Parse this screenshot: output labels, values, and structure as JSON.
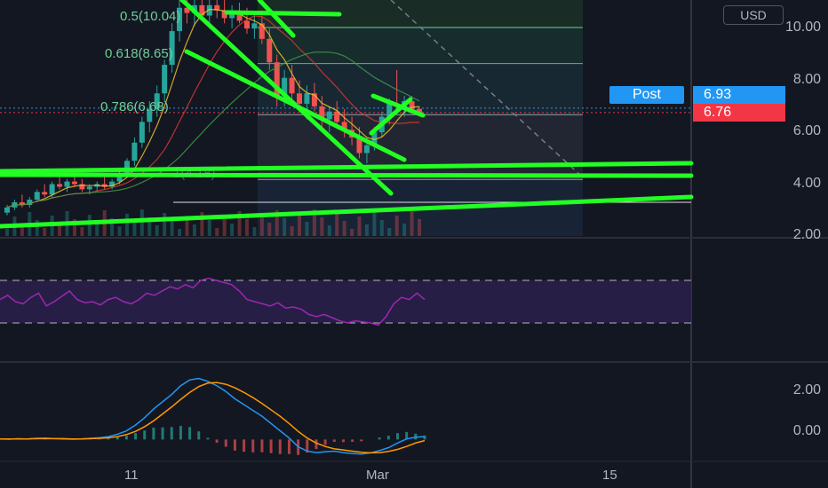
{
  "currency": "USD",
  "post_label": "Post",
  "price_badges": {
    "post_price": "6.93",
    "last_price": "6.76"
  },
  "fib_labels": {
    "level_050": "0.5(10.04)",
    "level_0618": "0.618(8.65)",
    "level_0786": "0.786(6.68)",
    "level_bottom": "1(4.18)"
  },
  "price_axis": {
    "ticks": [
      "10.00",
      "8.00",
      "6.00",
      "4.00",
      "2.00"
    ]
  },
  "macd_axis": {
    "ticks": [
      "2.00",
      "0.00"
    ]
  },
  "date_axis": {
    "ticks": [
      "11",
      "Mar",
      "15"
    ]
  },
  "colors": {
    "background": "#131722",
    "trendline": "#22ff22",
    "up_candle": "#26a69a",
    "down_candle": "#ef5350",
    "rsi": "#9c27b0",
    "macd": "#2196f3",
    "signal": "#ff9800"
  },
  "chart_data": {
    "type": "candlestick",
    "ylim": [
      2,
      11.1
    ],
    "price_levels": {
      "fib_050": 10.04,
      "fib_0618": 8.65,
      "fib_0786": 6.68,
      "fib_1": 4.18,
      "post": 6.93,
      "last": 6.76
    },
    "candles": [
      [
        2.9,
        3.2,
        2.8,
        3.1
      ],
      [
        3.1,
        3.4,
        3.0,
        3.3
      ],
      [
        3.3,
        3.6,
        3.1,
        3.2
      ],
      [
        3.2,
        3.5,
        3.1,
        3.4
      ],
      [
        3.4,
        3.8,
        3.3,
        3.7
      ],
      [
        3.7,
        4.0,
        3.5,
        3.6
      ],
      [
        3.6,
        4.1,
        3.5,
        4.0
      ],
      [
        4.0,
        4.3,
        3.8,
        3.9
      ],
      [
        3.9,
        4.2,
        3.7,
        4.1
      ],
      [
        4.1,
        4.4,
        3.9,
        4.0
      ],
      [
        4.0,
        4.2,
        3.7,
        3.8
      ],
      [
        3.8,
        4.0,
        3.6,
        3.9
      ],
      [
        3.9,
        4.1,
        3.7,
        4.0
      ],
      [
        4.0,
        4.3,
        3.8,
        3.9
      ],
      [
        3.9,
        4.2,
        3.8,
        4.1
      ],
      [
        4.1,
        4.5,
        4.0,
        4.4
      ],
      [
        4.4,
        5.0,
        4.3,
        4.9
      ],
      [
        4.9,
        5.8,
        4.7,
        5.6
      ],
      [
        5.6,
        6.6,
        5.4,
        6.4
      ],
      [
        6.4,
        7.2,
        6.0,
        6.9
      ],
      [
        6.9,
        7.8,
        6.6,
        7.5
      ],
      [
        7.5,
        8.8,
        7.2,
        8.6
      ],
      [
        8.6,
        10.2,
        8.3,
        9.9
      ],
      [
        9.9,
        11.1,
        9.5,
        10.8
      ],
      [
        10.8,
        11.1,
        10.2,
        10.6
      ],
      [
        10.6,
        11.1,
        10.1,
        10.9
      ],
      [
        10.9,
        11.1,
        10.3,
        10.5
      ],
      [
        10.5,
        11.1,
        10.0,
        10.9
      ],
      [
        10.9,
        11.1,
        10.4,
        10.7
      ],
      [
        10.7,
        11.1,
        10.2,
        10.4
      ],
      [
        10.4,
        10.9,
        10.0,
        10.6
      ],
      [
        10.6,
        11.0,
        10.2,
        10.3
      ],
      [
        10.3,
        10.8,
        9.8,
        10.0
      ],
      [
        10.0,
        10.6,
        9.6,
        10.2
      ],
      [
        10.2,
        10.5,
        9.4,
        9.6
      ],
      [
        9.6,
        10.0,
        8.4,
        8.7
      ],
      [
        8.7,
        9.0,
        7.0,
        7.4
      ],
      [
        7.4,
        8.4,
        7.0,
        8.1
      ],
      [
        8.1,
        8.6,
        7.2,
        7.5
      ],
      [
        7.5,
        8.0,
        6.8,
        7.1
      ],
      [
        7.1,
        7.8,
        6.5,
        7.5
      ],
      [
        7.5,
        7.9,
        6.8,
        7.0
      ],
      [
        7.0,
        7.4,
        6.2,
        6.5
      ],
      [
        6.5,
        7.0,
        6.0,
        6.8
      ],
      [
        6.8,
        7.2,
        6.2,
        6.4
      ],
      [
        6.4,
        6.9,
        5.8,
        6.1
      ],
      [
        6.1,
        6.6,
        5.5,
        5.8
      ],
      [
        5.8,
        6.2,
        5.0,
        5.2
      ],
      [
        5.2,
        5.8,
        4.8,
        5.5
      ],
      [
        5.5,
        6.2,
        5.3,
        6.0
      ],
      [
        6.0,
        6.8,
        5.8,
        6.6
      ],
      [
        6.6,
        7.3,
        6.3,
        7.1
      ],
      [
        7.1,
        8.4,
        6.9,
        7.0
      ],
      [
        7.0,
        7.4,
        6.6,
        7.2
      ],
      [
        7.2,
        7.4,
        6.7,
        6.9
      ],
      [
        6.9,
        7.0,
        6.6,
        6.76
      ]
    ],
    "trendlines": 9,
    "rsi": [
      52,
      56,
      50,
      48,
      54,
      58,
      46,
      50,
      55,
      60,
      52,
      49,
      50,
      47,
      52,
      54,
      50,
      48,
      52,
      58,
      56,
      60,
      64,
      62,
      66,
      63,
      70,
      72,
      70,
      68,
      66,
      60,
      52,
      50,
      48,
      46,
      49,
      44,
      45,
      43,
      38,
      36,
      38,
      35,
      32,
      30,
      32,
      31,
      30,
      28,
      36,
      48,
      54,
      52,
      58,
      52
    ],
    "rsi_band": [
      70,
      30
    ],
    "macd_line": [
      0.02,
      0.01,
      0.03,
      0.02,
      0.04,
      0.05,
      0.03,
      0.02,
      0.01,
      0.02,
      0.04,
      0.06,
      0.1,
      0.18,
      0.3,
      0.5,
      0.75,
      1.05,
      1.3,
      1.55,
      1.85,
      2.05,
      2.1,
      2.0,
      1.85,
      1.65,
      1.4,
      1.2,
      1.0,
      0.8,
      0.55,
      0.3,
      0.05,
      -0.25,
      -0.4,
      -0.45,
      -0.42,
      -0.4,
      -0.45,
      -0.48,
      -0.5,
      -0.46,
      -0.38,
      -0.28,
      -0.12,
      0.02,
      0.08,
      0.1
    ],
    "signal_line": [
      0.02,
      0.02,
      0.02,
      0.02,
      0.03,
      0.03,
      0.03,
      0.03,
      0.02,
      0.02,
      0.03,
      0.04,
      0.06,
      0.1,
      0.17,
      0.28,
      0.44,
      0.64,
      0.88,
      1.12,
      1.38,
      1.62,
      1.82,
      1.94,
      1.96,
      1.9,
      1.78,
      1.62,
      1.44,
      1.24,
      1.02,
      0.8,
      0.55,
      0.28,
      0.05,
      -0.12,
      -0.24,
      -0.32,
      -0.36,
      -0.4,
      -0.44,
      -0.46,
      -0.45,
      -0.41,
      -0.34,
      -0.24,
      -0.12,
      -0.04
    ],
    "macd_ylim": [
      -0.6,
      2.3
    ]
  }
}
